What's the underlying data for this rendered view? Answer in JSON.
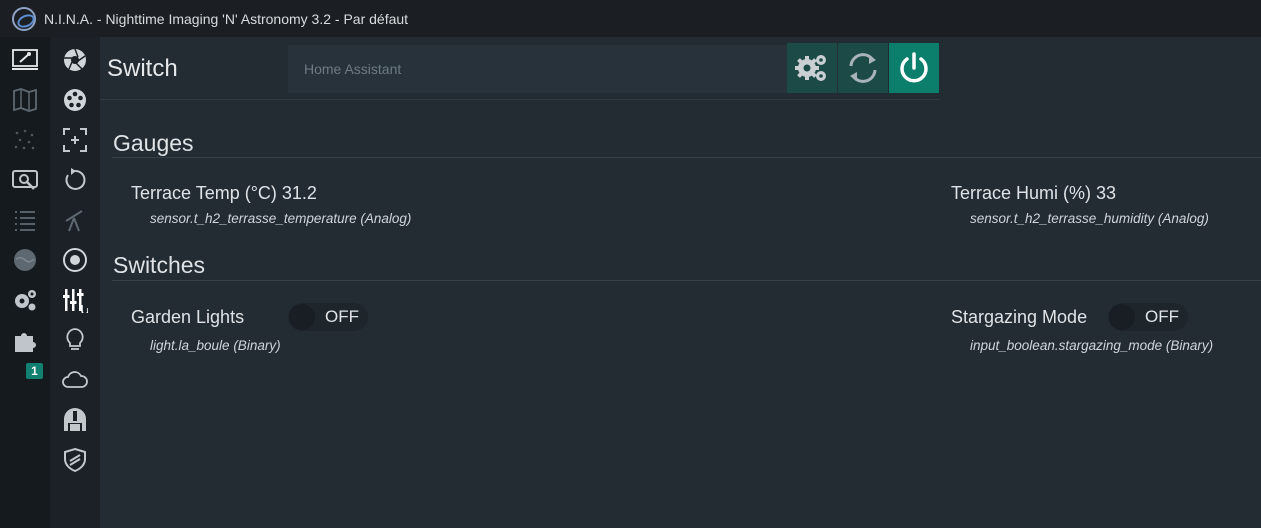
{
  "window": {
    "title": "N.I.N.A. - Nighttime Imaging 'N' Astronomy 3.2   -  Par défaut"
  },
  "nav_primary": [
    {
      "name": "imaging-tab",
      "icon": "telescope-screen-icon",
      "active": true
    },
    {
      "name": "framing-tab",
      "icon": "map-icon"
    },
    {
      "name": "sky-atlas-tab",
      "icon": "stars-icon"
    },
    {
      "name": "options-tab",
      "icon": "search-target-icon"
    },
    {
      "name": "sequencer-tab",
      "icon": "list-icon"
    },
    {
      "name": "sky-survey-tab",
      "icon": "globe-icon"
    },
    {
      "name": "settings-tab",
      "icon": "gear-icon"
    },
    {
      "name": "plugins-tab",
      "icon": "puzzle-icon",
      "badge": "1"
    }
  ],
  "nav_equipment": [
    {
      "name": "camera",
      "icon": "aperture-icon"
    },
    {
      "name": "filter-wheel",
      "icon": "filter-wheel-icon"
    },
    {
      "name": "focuser",
      "icon": "focus-icon"
    },
    {
      "name": "rotator",
      "icon": "rotate-icon"
    },
    {
      "name": "telescope",
      "icon": "telescope-icon"
    },
    {
      "name": "guider",
      "icon": "target-icon"
    },
    {
      "name": "switch",
      "icon": "sliders-icon",
      "active": true
    },
    {
      "name": "flat-device",
      "icon": "lightbulb-icon"
    },
    {
      "name": "weather",
      "icon": "cloud-icon"
    },
    {
      "name": "dome",
      "icon": "observatory-icon"
    },
    {
      "name": "safety-monitor",
      "icon": "shield-icon"
    }
  ],
  "header": {
    "title": "Switch",
    "device_selected": "Home Assistant",
    "buttons": {
      "settings": "settings-gears-icon",
      "refresh": "refresh-icon",
      "connect": "power-icon"
    }
  },
  "gauges": {
    "title": "Gauges",
    "items": [
      {
        "label": "Terrace Temp (°C) 31.2",
        "sub": "sensor.t_h2_terrasse_temperature (Analog)"
      },
      {
        "label": "Terrace Humi (%)  33",
        "sub": "sensor.t_h2_terrasse_humidity (Analog)"
      }
    ]
  },
  "switches": {
    "title": "Switches",
    "items": [
      {
        "label": "Garden Lights",
        "state": "OFF",
        "sub": "light.la_boule (Binary)"
      },
      {
        "label": "Stargazing Mode",
        "state": "OFF",
        "sub": "input_boolean.stargazing_mode (Binary)"
      }
    ]
  },
  "colors": {
    "accent": "#0c7e6c",
    "button_bg": "#1c4a46",
    "panel_bg": "#232c33"
  }
}
